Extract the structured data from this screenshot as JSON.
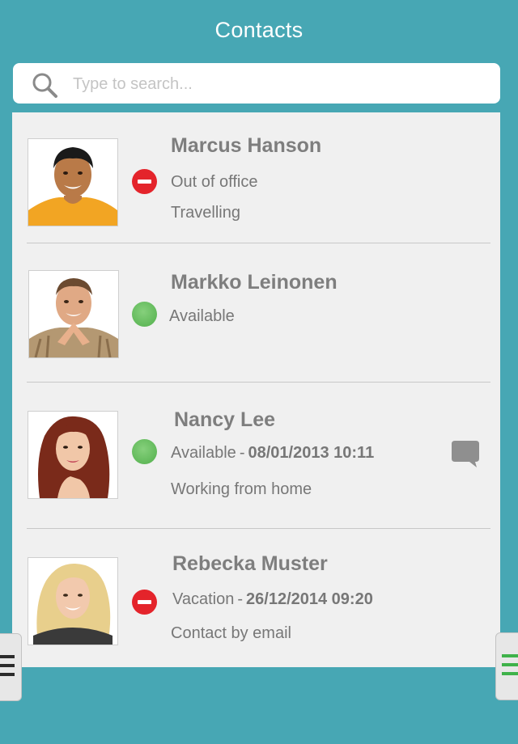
{
  "header": {
    "title": "Contacts"
  },
  "search": {
    "placeholder": "Type to search..."
  },
  "contacts": [
    {
      "name": "Marcus Hanson",
      "status": "busy",
      "status_label": "Out of office",
      "note": "Travelling",
      "icon": "do-not-disturb-icon"
    },
    {
      "name": "Markko Leinonen",
      "status": "available",
      "status_label": "Available",
      "icon": "available-icon"
    },
    {
      "name": "Nancy Lee",
      "status": "available",
      "status_label": "Available",
      "separator": "-",
      "status_date": "08/01/2013 10:11",
      "note": "Working from home",
      "icon": "available-icon",
      "has_chat": true
    },
    {
      "name": "Rebecka Muster",
      "status": "busy",
      "status_label": "Vacation",
      "separator": "-",
      "status_date": "26/12/2014 09:20",
      "note": "Contact by email",
      "icon": "do-not-disturb-icon"
    }
  ],
  "colors": {
    "background": "#47a7b4",
    "panel": "#f0f0f0",
    "busy": "#e4242b",
    "available": "#61b95a",
    "text": "#777777",
    "name_text": "#7e7e7e",
    "chat_icon": "#8f8f8f",
    "right_handle_lines": "#3fb24a"
  }
}
